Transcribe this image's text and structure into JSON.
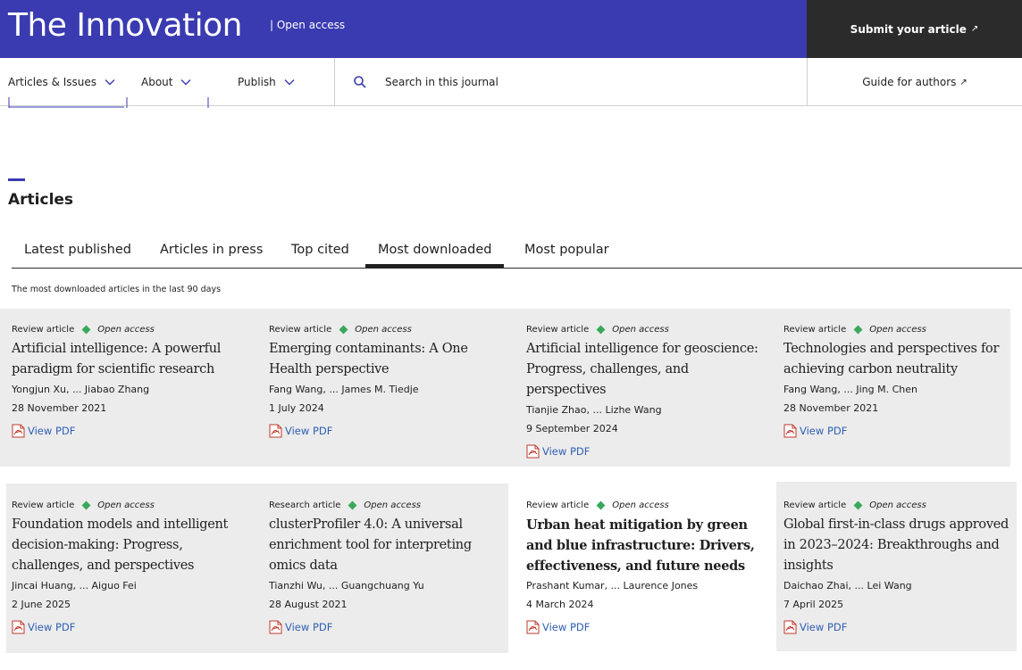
{
  "header": {
    "brand": "The Innovation",
    "open_access": "| Open access",
    "submit_label": "Submit your article",
    "submit_arrow": "↗"
  },
  "nav": {
    "items": [
      {
        "label": "Articles & Issues"
      },
      {
        "label": "About"
      },
      {
        "label": "Publish"
      }
    ],
    "search_placeholder": "Search in this journal",
    "guide_label": "Guide for authors",
    "guide_arrow": "↗"
  },
  "section": {
    "title": "Articles"
  },
  "tabs": {
    "items": [
      {
        "label": "Latest published",
        "active": false
      },
      {
        "label": "Articles in press",
        "active": false
      },
      {
        "label": "Top cited",
        "active": false
      },
      {
        "label": "Most downloaded",
        "active": true
      },
      {
        "label": "Most popular",
        "active": false
      }
    ],
    "note": "The most downloaded articles in the last 90 days"
  },
  "articles": [
    {
      "type": "Review article",
      "access": "Open access",
      "title": "Artificial intelligence: A powerful paradigm for scientific research",
      "authors": "Yongjun Xu, ... Jiabao Zhang",
      "date": "28 November 2021",
      "pdf": "View PDF"
    },
    {
      "type": "Review article",
      "access": "Open access",
      "title": "Emerging contaminants: A One Health perspective",
      "authors": "Fang Wang, ... James M. Tiedje",
      "date": "1 July 2024",
      "pdf": "View PDF"
    },
    {
      "type": "Review article",
      "access": "Open access",
      "title": "Artificial intelligence for geoscience: Progress, challenges, and perspectives",
      "authors": "Tianjie Zhao, ... Lizhe Wang",
      "date": "9 September 2024",
      "pdf": "View PDF"
    },
    {
      "type": "Review article",
      "access": "Open access",
      "title": "Technologies and perspectives for achieving carbon neutrality",
      "authors": "Fang Wang, ... Jing M. Chen",
      "date": "28 November 2021",
      "pdf": "View PDF"
    },
    {
      "type": "Review article",
      "access": "Open access",
      "title": "Foundation models and intelligent decision-making: Progress, challenges, and perspectives",
      "authors": "Jincai Huang, ... Aiguo Fei",
      "date": "2 June 2025",
      "pdf": "View PDF"
    },
    {
      "type": "Research article",
      "access": "Open access",
      "title": "clusterProfiler 4.0: A universal enrichment tool for interpreting omics data",
      "authors": "Tianzhi Wu, ... Guangchuang Yu",
      "date": "28 August 2021",
      "pdf": "View PDF"
    },
    {
      "type": "Review article",
      "access": "Open access",
      "title": "Urban heat mitigation by green and blue infrastructure: Drivers, effectiveness, and future needs",
      "authors": "Prashant Kumar, ... Laurence Jones",
      "date": "4 March 2024",
      "pdf": "View PDF"
    },
    {
      "type": "Review article",
      "access": "Open access",
      "title": "Global first-in-class drugs approved in 2023–2024: Breakthroughs and insights",
      "authors": "Daichao Zhai, ... Lei Wang",
      "date": "7 April 2025",
      "pdf": "View PDF"
    }
  ],
  "colors": {
    "brand_blue": "#3a3bb0",
    "submit_bg": "#2b2b2b",
    "open_access_green": "#3aa85a",
    "pdf_link": "#2f5fb3",
    "card_bg": "#ececec"
  }
}
